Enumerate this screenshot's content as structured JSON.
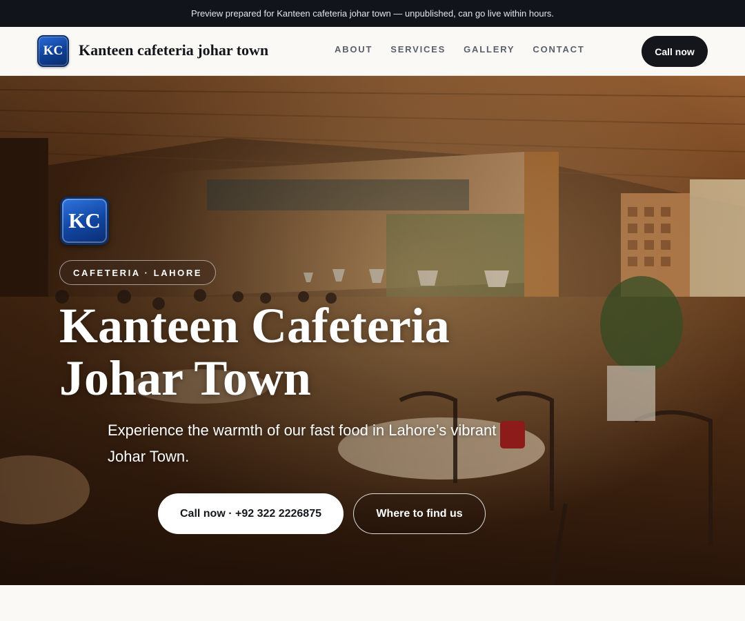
{
  "announcement": "Preview prepared for Kanteen cafeteria johar town — unpublished, can go live within hours.",
  "header": {
    "logo_initials": "KC",
    "brand_name": "Kanteen cafeteria johar town",
    "nav": [
      "ABOUT",
      "SERVICES",
      "GALLERY",
      "CONTACT"
    ],
    "cta_label": "Call now"
  },
  "hero": {
    "badge_initials": "KC",
    "tag": "CAFETERIA · LAHORE",
    "title": "Kanteen Cafeteria Johar Town",
    "subtitle": "Experience the warmth of our fast food in Lahore’s vibrant Johar Town.",
    "primary_button": "Call now · +92 322 2226875",
    "secondary_button": "Where to find us"
  },
  "colors": {
    "topbar_bg": "#11141a",
    "page_bg": "#faf9f6",
    "brand_blue": "#1145a0",
    "cta_dark": "#14161c"
  }
}
